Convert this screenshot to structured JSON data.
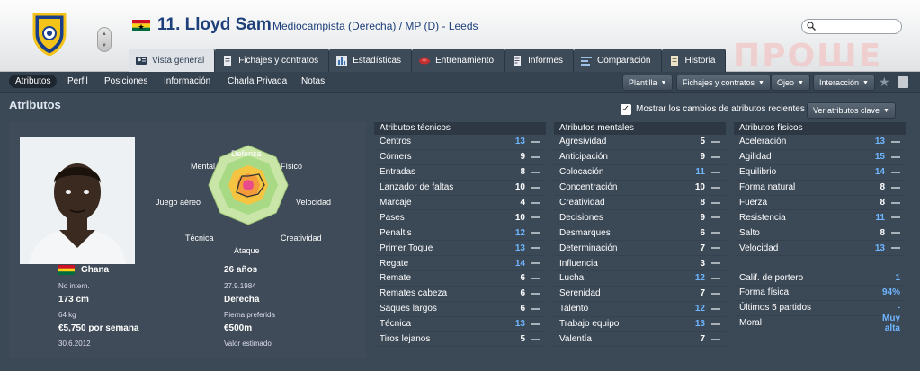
{
  "player": {
    "name": "11. Lloyd Sam",
    "subtitle": "Mediocampista (Derecha) / MP (D) - Leeds"
  },
  "tabs": [
    {
      "label": "Vista general",
      "icon": "person-card-icon",
      "active": true
    },
    {
      "label": "Fichajes y contratos",
      "icon": "document-icon",
      "active": false
    },
    {
      "label": "Estadísticas",
      "icon": "stats-icon",
      "active": false
    },
    {
      "label": "Entrenamiento",
      "icon": "training-icon",
      "active": false
    },
    {
      "label": "Informes",
      "icon": "report-icon",
      "active": false
    },
    {
      "label": "Comparación",
      "icon": "compare-icon",
      "active": false
    },
    {
      "label": "Historia",
      "icon": "history-icon",
      "active": false
    }
  ],
  "subnav": {
    "items": [
      "Atributos",
      "Perfil",
      "Posiciones",
      "Información",
      "Charla Privada",
      "Notas"
    ],
    "dropdowns": [
      "Plantilla",
      "Fichajes y contratos",
      "Ojeo",
      "Interacción"
    ]
  },
  "section": {
    "title": "Atributos",
    "recent_changes_label": "Mostrar los cambios de atributos recientes",
    "recent_changes_checked": true,
    "view_button": "Ver atributos clave"
  },
  "radar_labels": {
    "defensa": "Defensa",
    "fisico": "Físico",
    "velocidad": "Velocidad",
    "creatividad": "Creatividad",
    "ataque": "Ataque",
    "tecnica": "Técnica",
    "juego_aereo": "Juego aéreo",
    "mental": "Mental"
  },
  "info": {
    "nationality": "Ghana",
    "intl": "No intern.",
    "height": "173 cm",
    "weight": "64 kg",
    "wage": "€5,750 por semana",
    "contract_end": "30.6.2012",
    "age": "26 años",
    "dob": "27.9.1984",
    "foot": "Derecha",
    "foot_label": "Pierna preferida",
    "value": "€500m",
    "value_label": "Valor estimado"
  },
  "technical": {
    "header": "Atributos técnicos",
    "rows": [
      {
        "label": "Centros",
        "value": "13",
        "blue": true
      },
      {
        "label": "Córners",
        "value": "9",
        "blue": false
      },
      {
        "label": "Entradas",
        "value": "8",
        "blue": false
      },
      {
        "label": "Lanzador de faltas",
        "value": "10",
        "blue": false
      },
      {
        "label": "Marcaje",
        "value": "4",
        "blue": false
      },
      {
        "label": "Pases",
        "value": "10",
        "blue": false
      },
      {
        "label": "Penaltis",
        "value": "12",
        "blue": true
      },
      {
        "label": "Primer Toque",
        "value": "13",
        "blue": true
      },
      {
        "label": "Regate",
        "value": "14",
        "blue": true
      },
      {
        "label": "Remate",
        "value": "6",
        "blue": false
      },
      {
        "label": "Remates cabeza",
        "value": "6",
        "blue": false
      },
      {
        "label": "Saques largos",
        "value": "6",
        "blue": false
      },
      {
        "label": "Técnica",
        "value": "13",
        "blue": true
      },
      {
        "label": "Tiros lejanos",
        "value": "5",
        "blue": false
      }
    ]
  },
  "mental": {
    "header": "Atributos mentales",
    "rows": [
      {
        "label": "Agresividad",
        "value": "5",
        "blue": false
      },
      {
        "label": "Anticipación",
        "value": "9",
        "blue": false
      },
      {
        "label": "Colocación",
        "value": "11",
        "blue": true
      },
      {
        "label": "Concentración",
        "value": "10",
        "blue": false
      },
      {
        "label": "Creatividad",
        "value": "8",
        "blue": false
      },
      {
        "label": "Decisiones",
        "value": "9",
        "blue": false
      },
      {
        "label": "Desmarques",
        "value": "6",
        "blue": false
      },
      {
        "label": "Determinación",
        "value": "7",
        "blue": false
      },
      {
        "label": "Influencia",
        "value": "3",
        "blue": false
      },
      {
        "label": "Lucha",
        "value": "12",
        "blue": true
      },
      {
        "label": "Serenidad",
        "value": "7",
        "blue": false
      },
      {
        "label": "Talento",
        "value": "12",
        "blue": true
      },
      {
        "label": "Trabajo equipo",
        "value": "13",
        "blue": true
      },
      {
        "label": "Valentía",
        "value": "7",
        "blue": false
      }
    ]
  },
  "physical": {
    "header": "Atributos físicos",
    "rows": [
      {
        "label": "Aceleración",
        "value": "13",
        "blue": true
      },
      {
        "label": "Agilidad",
        "value": "15",
        "blue": true
      },
      {
        "label": "Equilibrio",
        "value": "14",
        "blue": true
      },
      {
        "label": "Forma natural",
        "value": "8",
        "blue": false
      },
      {
        "label": "Fuerza",
        "value": "8",
        "blue": false
      },
      {
        "label": "Resistencia",
        "value": "11",
        "blue": true
      },
      {
        "label": "Salto",
        "value": "8",
        "blue": false
      },
      {
        "label": "Velocidad",
        "value": "13",
        "blue": true
      }
    ],
    "extra": [
      {
        "label": "Calif. de portero",
        "value": "1"
      },
      {
        "label": "Forma física",
        "value": "94%"
      },
      {
        "label": "Últimos 5 partidos",
        "value": "-"
      },
      {
        "label": "Moral",
        "value": "Muy alta"
      }
    ]
  },
  "colors": {
    "accent_blue": "#6fb5ff",
    "title_blue": "#1d3f7a",
    "panel": "#3f4b58"
  }
}
